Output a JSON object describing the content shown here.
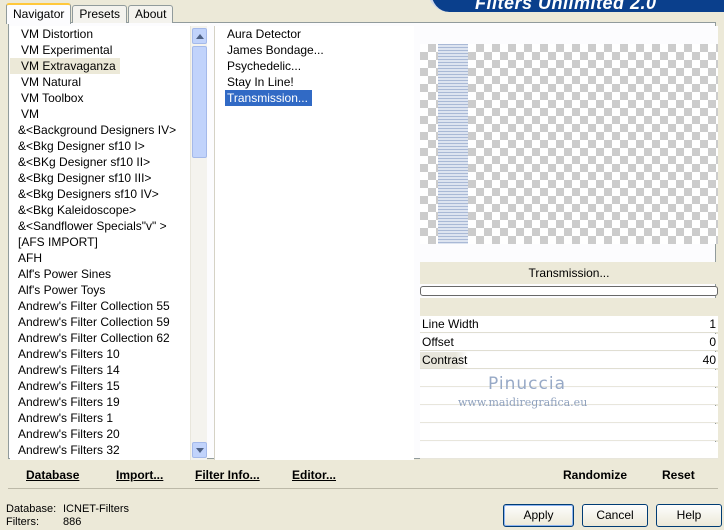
{
  "title": "Filters Unlimited 2.0",
  "tabs": [
    {
      "label": "Navigator",
      "active": true
    },
    {
      "label": "Presets",
      "active": false
    },
    {
      "label": "About",
      "active": false
    }
  ],
  "categories": [
    "VM Distortion",
    "VM Experimental",
    "VM Extravaganza",
    "VM Natural",
    "VM Toolbox",
    "VM",
    "&<Background Designers IV>",
    "&<Bkg Designer sf10 I>",
    "&<BKg Designer sf10 II>",
    "&<Bkg Designer sf10 III>",
    "&<Bkg Designers sf10 IV>",
    "&<Bkg Kaleidoscope>",
    "&<Sandflower Specials\"v\" >",
    "[AFS IMPORT]",
    "AFH",
    "Alf's Power Sines",
    "Alf's Power Toys",
    "Andrew's Filter Collection 55",
    "Andrew's Filter Collection 59",
    "Andrew's Filter Collection 62",
    "Andrew's Filters 10",
    "Andrew's Filters 14",
    "Andrew's Filters 15",
    "Andrew's Filters 19",
    "Andrew's Filters 1",
    "Andrew's Filters 20",
    "Andrew's Filters 32"
  ],
  "selected_category": "VM Extravaganza",
  "filters": [
    "Aura Detector",
    "James Bondage...",
    "Psychedelic...",
    "Stay In Line!",
    "Transmission..."
  ],
  "selected_filter": "Transmission...",
  "preview_caption": "Transmission...",
  "params": [
    {
      "label": "Line Width",
      "value": "1"
    },
    {
      "label": "Offset",
      "value": "0"
    },
    {
      "label": "Contrast",
      "value": "40"
    }
  ],
  "watermark": {
    "line1": "Pinuccia",
    "line2": "www.maidiregrafica.eu"
  },
  "toolbar": {
    "database": "Database",
    "import": "Import...",
    "filter_info": "Filter Info...",
    "editor": "Editor...",
    "randomize": "Randomize",
    "reset": "Reset"
  },
  "status": {
    "database_label": "Database:",
    "database_value": "ICNET-Filters",
    "filters_label": "Filters:",
    "filters_value": "886"
  },
  "buttons": {
    "apply": "Apply",
    "cancel": "Cancel",
    "help": "Help"
  }
}
